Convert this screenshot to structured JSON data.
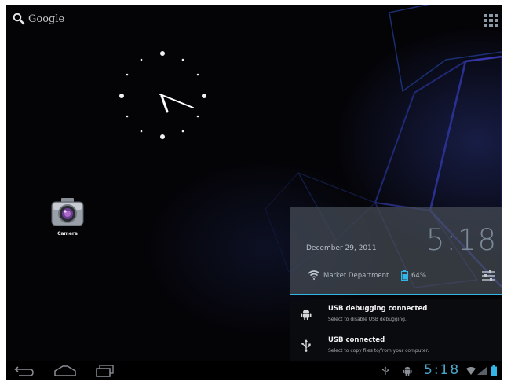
{
  "search": {
    "label": "Google",
    "icon": "search-icon"
  },
  "apps_button": {
    "icon": "all-apps-icon"
  },
  "clock": {
    "type": "analog-clock"
  },
  "shortcuts": [
    {
      "label": "Camera",
      "icon": "camera-icon"
    }
  ],
  "notification_panel": {
    "date": "December 29, 2011",
    "time": "5:18",
    "network_name": "Market Department",
    "battery_percent": "64%",
    "accent_color": "#33b5e5",
    "items": [
      {
        "icon": "android-debug-icon",
        "title": "USB debugging connected",
        "subtitle": "Select to disable USB debugging."
      },
      {
        "icon": "usb-icon",
        "title": "USB connected",
        "subtitle": "Select to copy files to/from your computer."
      }
    ]
  },
  "status_bar": {
    "time": "5:18",
    "time_color": "#4aa6c8",
    "icons": [
      "usb-icon",
      "android-debug-icon",
      "wifi-icon",
      "signal-icon",
      "battery-icon"
    ]
  },
  "nav_buttons": [
    "back-icon",
    "home-icon",
    "recent-apps-icon"
  ]
}
